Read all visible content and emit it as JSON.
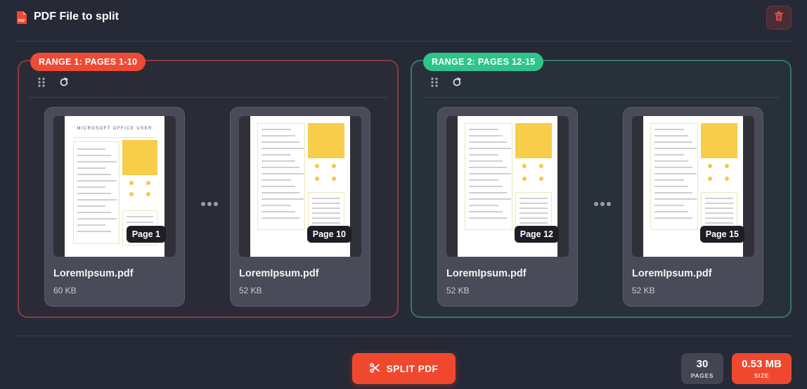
{
  "header": {
    "title": "PDF File to split",
    "pdf_icon_label": "PDF"
  },
  "ranges": [
    {
      "label": "RANGE 1: PAGES 1-10",
      "color": "#ef4a33",
      "cards": [
        {
          "file": "LoremIpsum.pdf",
          "size": "60 KB",
          "page": "Page 1"
        },
        {
          "file": "LoremIpsum.pdf",
          "size": "52 KB",
          "page": "Page 10"
        }
      ]
    },
    {
      "label": "RANGE 2: PAGES 12-15",
      "color": "#2fc48a",
      "cards": [
        {
          "file": "LoremIpsum.pdf",
          "size": "52 KB",
          "page": "Page 12"
        },
        {
          "file": "LoremIpsum.pdf",
          "size": "52 KB",
          "page": "Page 15"
        }
      ]
    }
  ],
  "doc_title": "MICROSOFT OFFICE USER",
  "split_button": "SPLIT PDF",
  "stats": {
    "pages_value": "30",
    "pages_label": "PAGES",
    "size_value": "0.53 MB",
    "size_label": "SIZE"
  },
  "colors": {
    "accent": "#f0482f",
    "range1": "#ef4a33",
    "range2": "#2fc48a",
    "background": "#262936"
  },
  "icons": {
    "drag": "drag-handle-icon",
    "rotate": "rotate-icon",
    "delete": "trash-icon",
    "split": "scissors-icon",
    "file": "pdf-file-icon"
  }
}
